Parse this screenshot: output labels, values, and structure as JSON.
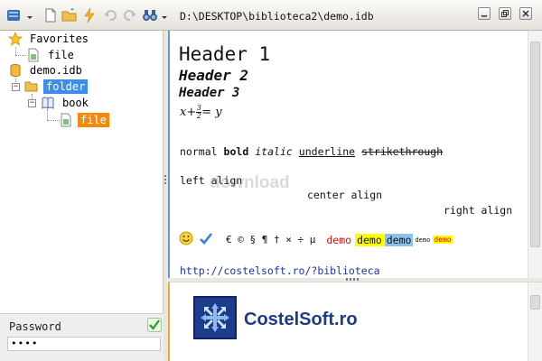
{
  "toolbar": {
    "path": "D:\\DESKTOP\\biblioteca2\\demo.idb"
  },
  "tree": {
    "favorites_label": "Favorites",
    "favorite_file_label": "file",
    "db_label": "demo.idb",
    "folder_label": "folder",
    "book_label": "book",
    "file_label": "file"
  },
  "password": {
    "label": "Password",
    "value": "••••"
  },
  "document": {
    "header1": "Header 1",
    "header2": "Header 2",
    "header3": "Header 3",
    "formula": {
      "lhs": "x+",
      "num": "3",
      "den": "2",
      "rhs": "= y"
    },
    "formatting": {
      "normal": "normal",
      "bold": "bold",
      "italic": "italic",
      "underline": "underline",
      "strike": "strikethrough"
    },
    "align": {
      "left": "left align",
      "center": "center align",
      "right": "right align"
    },
    "symbols": "€ © § ¶ † × ÷ µ",
    "demo": [
      "demo",
      "demo",
      "demo",
      "demo",
      "demo"
    ],
    "link": "http://costelsoft.ro/?biblioteca"
  },
  "preview": {
    "logo_text": "CostelSoft.ro"
  },
  "watermark": "download",
  "colors": {
    "selection_blue": "#3d8ee9",
    "selection_orange": "#f58a0a",
    "link": "#1f2fa6",
    "highlight_yellow": "#ffff00",
    "highlight_blue": "#8fc1ef",
    "demo_red": "#d01010"
  }
}
